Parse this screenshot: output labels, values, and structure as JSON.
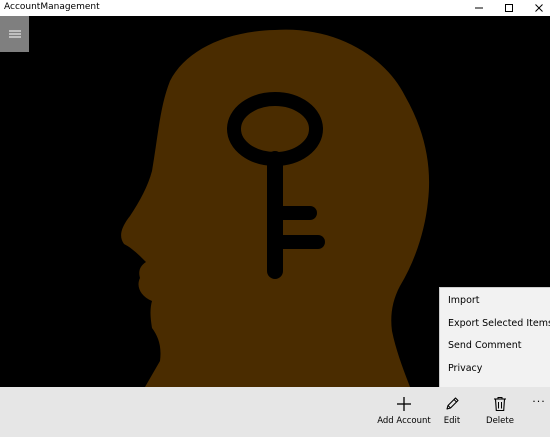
{
  "window": {
    "title": "AccountManagement"
  },
  "hero": {
    "head_color": "#4a2c00",
    "key_color": "#000000"
  },
  "commandbar": {
    "add_label": "Add Account",
    "edit_label": "Edit",
    "delete_label": "Delete",
    "more_label": "···"
  },
  "overflow_menu": {
    "items": [
      {
        "label": "Import"
      },
      {
        "label": "Export Selected Items"
      },
      {
        "label": "Send Comment"
      },
      {
        "label": "Privacy"
      }
    ]
  }
}
